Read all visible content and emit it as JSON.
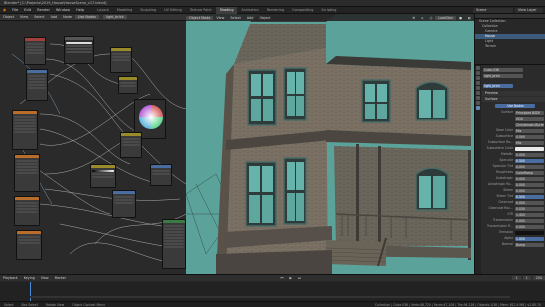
{
  "window": {
    "title": "Blender* [C:\\Projects\\2019_House\\HouseScene_v17.blend]"
  },
  "menus": [
    "File",
    "Edit",
    "Render",
    "Window",
    "Help"
  ],
  "workspace_tabs": [
    "Layout",
    "Modeling",
    "Sculpting",
    "UV Editing",
    "Texture Paint",
    "Shading",
    "Animation",
    "Rendering",
    "Compositing",
    "Scripting"
  ],
  "active_tab": "Shading",
  "scene_name": "Scene",
  "view_layer": "View Layer",
  "node_editor": {
    "header_items": [
      "Object",
      "View",
      "Select",
      "Add",
      "Node",
      "Use Nodes"
    ],
    "material_slot": "light_brick"
  },
  "viewport": {
    "header_items": [
      "Object Mode",
      "View",
      "Select",
      "Add",
      "Object"
    ],
    "shading_mode": "LookDev"
  },
  "outliner": {
    "rows": [
      "Scene Collection",
      "Collection",
      "Camera",
      "House",
      "Light",
      "Terrain"
    ],
    "selected": "House"
  },
  "properties": {
    "object_label": "Cube.036",
    "material_name": "light_brick",
    "material_data_name": "light_brick",
    "sections": [
      "Preview",
      "Surface",
      "Use Nodes"
    ],
    "surface_shader": "Principled BSDF",
    "rows": [
      {
        "label": "Surface",
        "value": "Principled BSDF"
      },
      {
        "label": "",
        "value": "GGX"
      },
      {
        "label": "",
        "value": "Christensen-Burley"
      },
      {
        "label": "Base Color",
        "value": "Mix"
      },
      {
        "label": "Subsurface",
        "value": "0.000"
      },
      {
        "label": "Subsurface Ra...",
        "value": "Mix"
      },
      {
        "label": "Subsurface Color",
        "value": ""
      },
      {
        "label": "Metallic",
        "value": "0.000"
      },
      {
        "label": "Specular",
        "value": "0.500"
      },
      {
        "label": "Specular Tint",
        "value": "0.000"
      },
      {
        "label": "Roughness",
        "value": "ColorRamp"
      },
      {
        "label": "Anisotropic",
        "value": "0.000"
      },
      {
        "label": "Anisotropic Ro...",
        "value": "0.000"
      },
      {
        "label": "Sheen",
        "value": "0.000"
      },
      {
        "label": "Sheen Tint",
        "value": "0.500"
      },
      {
        "label": "Clearcoat",
        "value": "0.000"
      },
      {
        "label": "Clearcoat Rou...",
        "value": "0.030"
      },
      {
        "label": "IOR",
        "value": "1.450"
      },
      {
        "label": "Transmission",
        "value": "0.000"
      },
      {
        "label": "Transmission R...",
        "value": "0.000"
      },
      {
        "label": "Emission",
        "value": ""
      },
      {
        "label": "Alpha",
        "value": "1.000"
      },
      {
        "label": "Normal",
        "value": "Bump"
      }
    ]
  },
  "timeline": {
    "header_items": [
      "Playback",
      "Keying",
      "View",
      "Marker"
    ],
    "start": "1",
    "end": "250",
    "current": "1"
  },
  "statusbar": {
    "left": "Select",
    "middle": "Box Select",
    "rotate": "Rotate View",
    "context": "Object Context Menu",
    "stats": "Collection | Cube.036 | Verts:48,720 | Faces:47,108 | Tris:94,216 | Objects:1/38 | Mem: 612.4 MB | v2.80.74"
  }
}
